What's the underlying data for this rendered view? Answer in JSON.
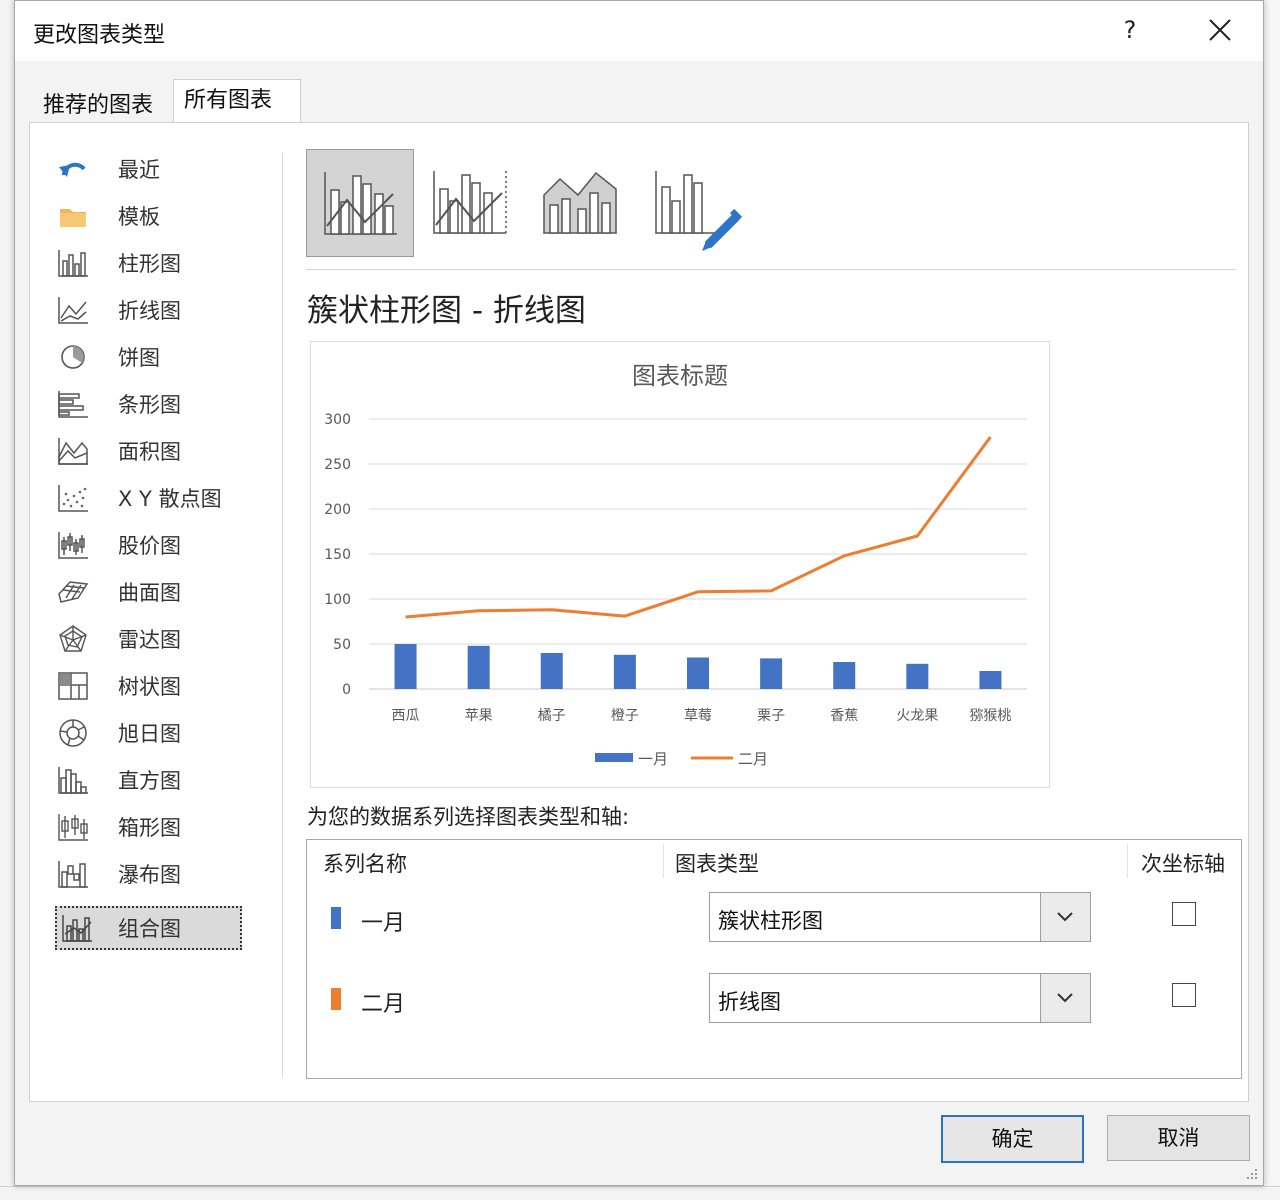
{
  "dialog": {
    "title": "更改图表类型",
    "help_label": "?",
    "tabs": [
      {
        "label": "推荐的图表",
        "active": false
      },
      {
        "label": "所有图表",
        "active": true
      }
    ]
  },
  "sidebar": {
    "items": [
      {
        "label": "最近",
        "icon": "recent-icon"
      },
      {
        "label": "模板",
        "icon": "folder-icon"
      },
      {
        "label": "柱形图",
        "icon": "column-chart-icon"
      },
      {
        "label": "折线图",
        "icon": "line-chart-icon"
      },
      {
        "label": "饼图",
        "icon": "pie-chart-icon"
      },
      {
        "label": "条形图",
        "icon": "bar-chart-icon"
      },
      {
        "label": "面积图",
        "icon": "area-chart-icon"
      },
      {
        "label": "X Y 散点图",
        "icon": "scatter-chart-icon"
      },
      {
        "label": "股价图",
        "icon": "stock-chart-icon"
      },
      {
        "label": "曲面图",
        "icon": "surface-chart-icon"
      },
      {
        "label": "雷达图",
        "icon": "radar-chart-icon"
      },
      {
        "label": "树状图",
        "icon": "treemap-chart-icon"
      },
      {
        "label": "旭日图",
        "icon": "sunburst-chart-icon"
      },
      {
        "label": "直方图",
        "icon": "histogram-chart-icon"
      },
      {
        "label": "箱形图",
        "icon": "box-chart-icon"
      },
      {
        "label": "瀑布图",
        "icon": "waterfall-chart-icon"
      },
      {
        "label": "组合图",
        "icon": "combo-chart-icon",
        "selected": true
      }
    ]
  },
  "main": {
    "subtypes": [
      {
        "icon": "clustered-column-line-icon",
        "selected": true
      },
      {
        "icon": "clustered-column-line-secondary-axis-icon",
        "selected": false
      },
      {
        "icon": "stacked-area-clustered-column-icon",
        "selected": false
      },
      {
        "icon": "custom-combination-icon",
        "selected": false
      }
    ],
    "chart_type_title": "簇状柱形图 - 折线图",
    "series_prompt": "为您的数据系列选择图表类型和轴:",
    "table": {
      "headers": {
        "series_name": "系列名称",
        "chart_type": "图表类型",
        "secondary_axis": "次坐标轴"
      },
      "rows": [
        {
          "name": "一月",
          "color": "#4472C4",
          "chart_type": "簇状柱形图",
          "secondary_axis": false
        },
        {
          "name": "二月",
          "color": "#ED7D31",
          "chart_type": "折线图",
          "secondary_axis": false
        }
      ]
    }
  },
  "footer": {
    "ok_label": "确定",
    "cancel_label": "取消"
  },
  "chart_data": {
    "type": "bar",
    "title": "图表标题",
    "categories": [
      "西瓜",
      "苹果",
      "橘子",
      "橙子",
      "草莓",
      "栗子",
      "香蕉",
      "火龙果",
      "猕猴桃"
    ],
    "series": [
      {
        "name": "一月",
        "type": "bar",
        "color": "#4472C4",
        "values": [
          50,
          48,
          40,
          38,
          35,
          34,
          30,
          28,
          20
        ]
      },
      {
        "name": "二月",
        "type": "line",
        "color": "#ED7D31",
        "values": [
          80,
          87,
          88,
          81,
          108,
          109,
          148,
          170,
          280
        ]
      }
    ],
    "yticks": [
      0,
      50,
      100,
      150,
      200,
      250,
      300
    ],
    "ylim": [
      0,
      300
    ],
    "grid": true,
    "legend": "bottom"
  }
}
